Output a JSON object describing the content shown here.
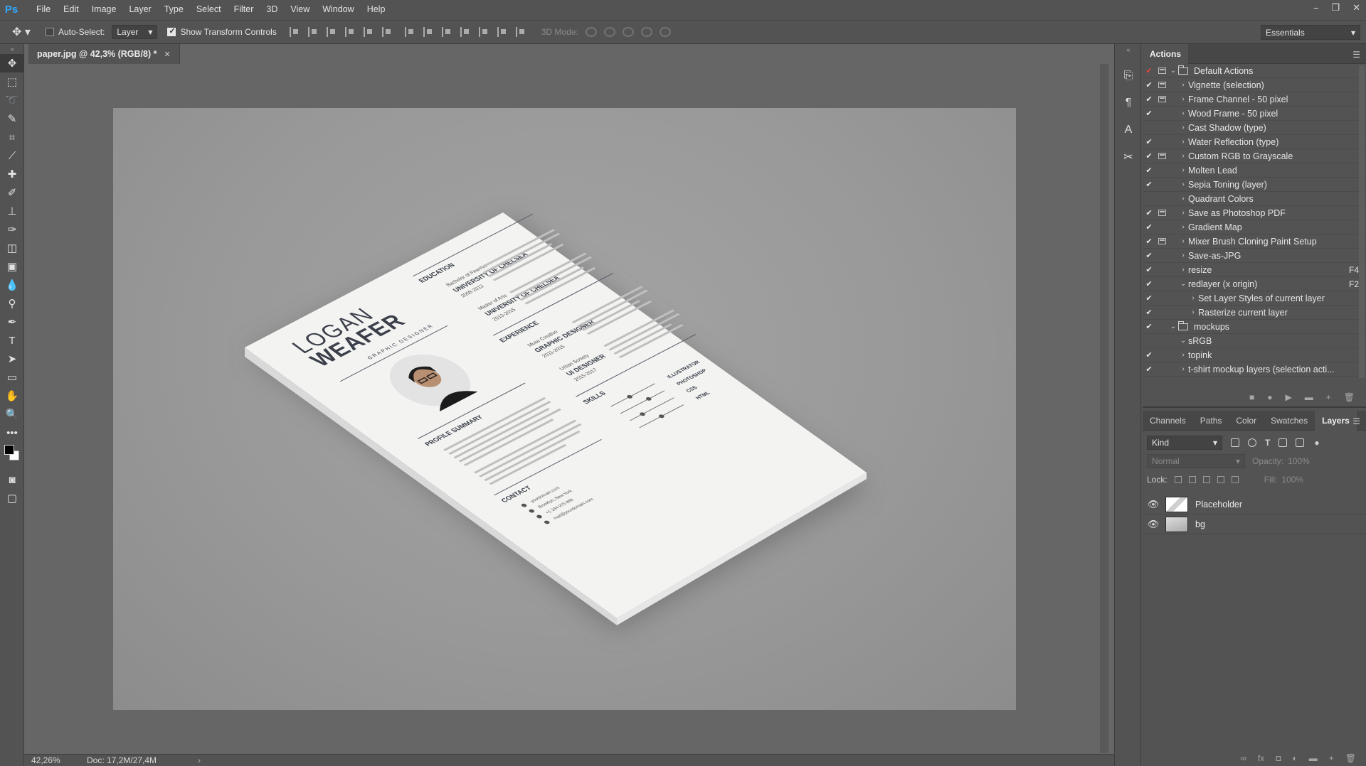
{
  "app": {
    "logo": "Ps"
  },
  "menu": [
    "File",
    "Edit",
    "Image",
    "Layer",
    "Type",
    "Select",
    "Filter",
    "3D",
    "View",
    "Window",
    "Help"
  ],
  "window_controls": [
    "−",
    "❐",
    "✕"
  ],
  "options_bar": {
    "auto_select_label": "Auto-Select:",
    "auto_select_checked": false,
    "auto_select_target": "Layer",
    "show_transform_label": "Show Transform Controls",
    "show_transform_checked": true,
    "mode_3d_label": "3D Mode:",
    "workspace": "Essentials"
  },
  "document": {
    "tab_title": "paper.jpg @ 42,3% (RGB/8) *",
    "zoom": "42,26%",
    "doc_size": "Doc: 17,2M/27,4M"
  },
  "resume": {
    "first_name": "LOGAN",
    "last_name": "WEAFER",
    "role": "GRAPHIC DESIGNER",
    "education_heading": "EDUCATION",
    "edu1_degree": "Bachelor of Fine Art",
    "edu1_school": "UNIVERSITY OF CHELSEA",
    "edu1_years": "2008-2012",
    "edu2_degree": "Master of Arts",
    "edu2_school": "UNIVERSITY OF CHELSEA",
    "edu2_years": "2013-2015",
    "experience_heading": "EXPERIENCE",
    "exp1_company": "Muse Creative",
    "exp1_title": "GRAPHIC DESIGNER",
    "exp1_years": "2011-2015",
    "exp2_company": "Urban Society",
    "exp2_title": "UI DESIGNER",
    "exp2_years": "2015-2017",
    "profile_heading": "PROFILE SUMMARY",
    "skills_heading": "SKILLS",
    "skills": [
      "ILLUSTRATOR",
      "PHOTOSHOP",
      "CSS",
      "HTML"
    ],
    "contact_heading": "CONTACT",
    "contact": [
      "yourdomain.com",
      "Brooklyn, New York",
      "+1 234 975 888",
      "mail@yourdomain.com"
    ]
  },
  "actions_panel": {
    "tab": "Actions",
    "items": [
      {
        "label": "Default Actions",
        "type": "set",
        "check": "red",
        "dialog": true,
        "expanded": true
      },
      {
        "label": "Vignette (selection)",
        "type": "action",
        "check": "on",
        "dialog": true
      },
      {
        "label": "Frame Channel - 50 pixel",
        "type": "action",
        "check": "on",
        "dialog": true
      },
      {
        "label": "Wood Frame - 50 pixel",
        "type": "action",
        "check": "on",
        "dialog": false
      },
      {
        "label": "Cast Shadow (type)",
        "type": "action",
        "check": "off",
        "dialog": false
      },
      {
        "label": "Water Reflection (type)",
        "type": "action",
        "check": "on",
        "dialog": false
      },
      {
        "label": "Custom RGB to Grayscale",
        "type": "action",
        "check": "on",
        "dialog": true
      },
      {
        "label": "Molten Lead",
        "type": "action",
        "check": "on",
        "dialog": false
      },
      {
        "label": "Sepia Toning (layer)",
        "type": "action",
        "check": "on",
        "dialog": false
      },
      {
        "label": "Quadrant Colors",
        "type": "action",
        "check": "off",
        "dialog": false
      },
      {
        "label": "Save as Photoshop PDF",
        "type": "action",
        "check": "on",
        "dialog": true
      },
      {
        "label": "Gradient Map",
        "type": "action",
        "check": "on",
        "dialog": false
      },
      {
        "label": "Mixer Brush Cloning Paint Setup",
        "type": "action",
        "check": "on",
        "dialog": true
      },
      {
        "label": "Save-as-JPG",
        "type": "action",
        "check": "on",
        "dialog": false
      },
      {
        "label": "resize",
        "type": "action",
        "check": "on",
        "dialog": false,
        "key": "F4"
      },
      {
        "label": "redlayer (x origin)",
        "type": "action",
        "check": "on",
        "dialog": false,
        "key": "F2",
        "expanded": true
      },
      {
        "label": "Set Layer Styles of current layer",
        "type": "step",
        "check": "on",
        "dialog": false
      },
      {
        "label": "Rasterize current layer",
        "type": "step",
        "check": "on",
        "dialog": false
      },
      {
        "label": "mockups",
        "type": "set",
        "check": "on",
        "dialog": false,
        "expanded": true
      },
      {
        "label": "sRGB",
        "type": "action",
        "check": "off",
        "dialog": false,
        "expanded": true
      },
      {
        "label": "topink",
        "type": "action",
        "check": "on",
        "dialog": false
      },
      {
        "label": "t-shirt mockup layers (selection acti...",
        "type": "action",
        "check": "on",
        "dialog": false
      }
    ],
    "footer_icons": [
      "■",
      "●",
      "▶",
      "▬",
      "+",
      "🗑"
    ]
  },
  "layers_panel": {
    "tabs": [
      "Channels",
      "Paths",
      "Color",
      "Swatches",
      "Layers"
    ],
    "active_tab": "Layers",
    "kind_label": "Kind",
    "blend_mode": "Normal",
    "opacity_label": "Opacity:",
    "opacity_value": "100%",
    "lock_label": "Lock:",
    "fill_label": "Fill:",
    "fill_value": "100%",
    "layers": [
      {
        "name": "Placeholder",
        "visible": true,
        "thumb": "ph"
      },
      {
        "name": "bg",
        "visible": true,
        "thumb": "bg"
      }
    ],
    "footer_icons": [
      "∞",
      "fx",
      "◘",
      "◐",
      "▬",
      "+",
      "🗑"
    ]
  }
}
